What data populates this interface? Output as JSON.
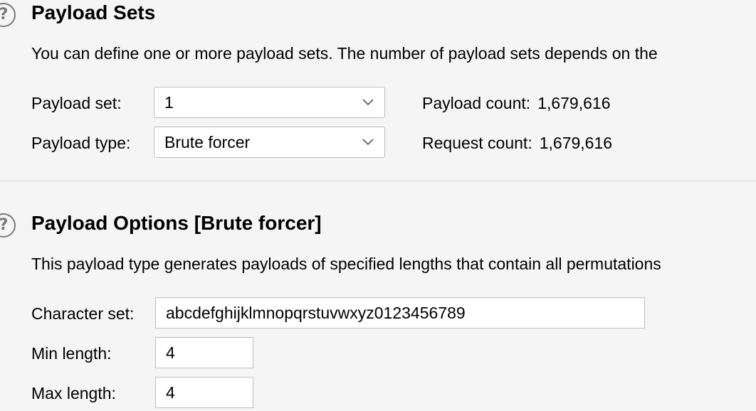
{
  "payload_sets": {
    "help_glyph": "?",
    "title": "Payload Sets",
    "description": "You can define one or more payload sets. The number of payload sets depends on the",
    "payload_set_label": "Payload set:",
    "payload_set_value": "1",
    "payload_type_label": "Payload type:",
    "payload_type_value": "Brute forcer",
    "payload_count_label": "Payload count:",
    "payload_count_value": "1,679,616",
    "request_count_label": "Request count:",
    "request_count_value": "1,679,616"
  },
  "payload_options": {
    "help_glyph": "?",
    "title": "Payload Options [Brute forcer]",
    "description": "This payload type generates payloads of specified lengths that contain all permutations",
    "character_set_label": "Character set:",
    "character_set_value": "abcdefghijklmnopqrstuvwxyz0123456789",
    "min_length_label": "Min length:",
    "min_length_value": "4",
    "max_length_label": "Max length:",
    "max_length_value": "4"
  },
  "icons": {
    "help": "help-icon",
    "dropdown": "chevron-down-icon"
  },
  "colors": {
    "background": "#f5f5f5",
    "field_background": "#ffffff",
    "border": "#bdbdbd",
    "icon": "#7a7a7a"
  }
}
